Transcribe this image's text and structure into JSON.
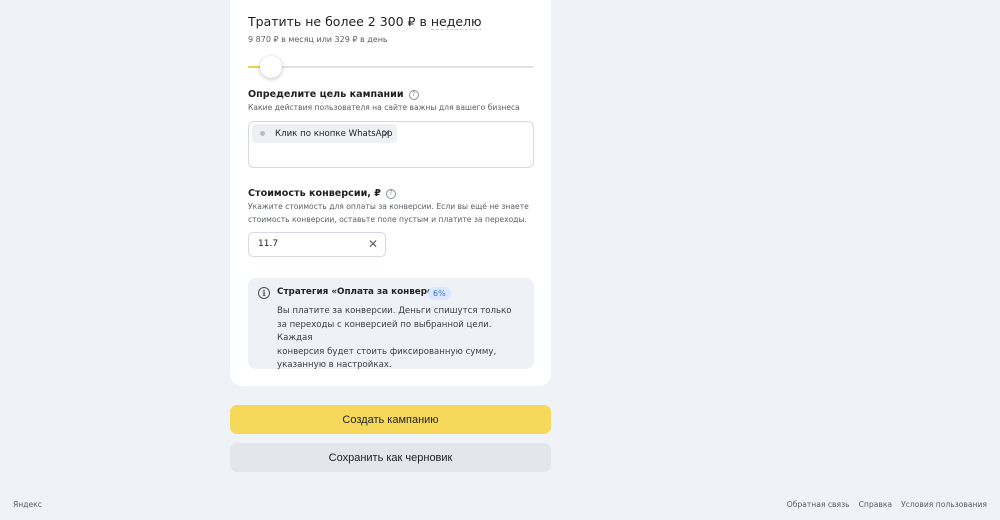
{
  "budget": {
    "prefix": "Тратить не более 2 300 ₽ в",
    "period": "неделю",
    "subtitle": "9 870 ₽ в месяц или 329 ₽ в день",
    "slider_fraction": 0.08
  },
  "goal": {
    "title": "Определите цель кампании",
    "description": "Какие действия пользователя на сайте важны для вашего бизнеса",
    "chip_label": "Клик по кнопке WhatsApp"
  },
  "conversion": {
    "title": "Стоимость конверсии, ₽",
    "description_line1": "Укажите стоимость для оплаты за конверсии. Если вы ещё не знаете",
    "description_line2": "стоимость конверсии, оставьте поле пустым и платите за переходы.",
    "value": "11.7"
  },
  "strategy": {
    "title": "Стратегия «Оплата за конверсии»",
    "badge": "6%",
    "text_line1": "Вы платите за конверсии. Деньги спишутся только",
    "text_line2": "за переходы с конверсией по выбранной цели. Каждая",
    "text_line3": "конверсия будет стоить фиксированную сумму,",
    "text_line4": "указанную в настройках."
  },
  "actions": {
    "create_label": "Создать кампанию",
    "draft_label": "Сохранить как черновик"
  },
  "footer": {
    "brand": "Яндекс",
    "feedback": "Обратная связь",
    "help": "Справка",
    "terms": "Условия пользования"
  },
  "colors": {
    "accent": "#f6d95b",
    "slider_fill": "#f6cf3d",
    "badge_text": "#3a76d8",
    "background": "#eff2f6"
  }
}
